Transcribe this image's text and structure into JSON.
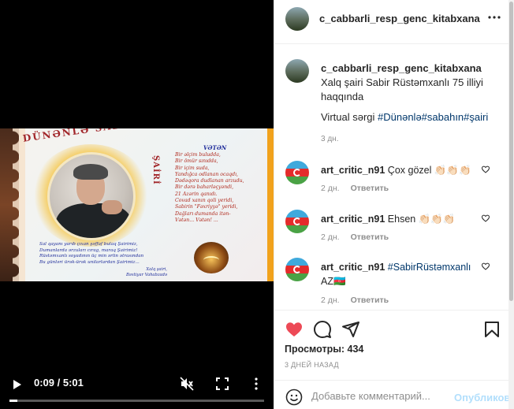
{
  "video": {
    "time": "0:09 / 5:01",
    "progress_fraction": 0.03,
    "poster": {
      "title": "DÜNƏNLƏ SABAHIN",
      "title_vertical": "ŞAİRİ",
      "poem_title": "VƏTƏN",
      "poem": "Bir əlçim buludda,\nBir ömür sınıdda,\nBir içim suda,\nYandığca odlanan ocaqdı,\nDədəqora dudlanan arzudu,\nBir dərə baharləçyəndi,\n21 Azərin qanıdı.\nCovad xanın qoli yeridi,\nSabirin \"Fəxriyyə\" yeridi,\nDağları dumanda itən-\nVətən... Vətən! ...",
      "prose": "Sal qayanı yarıb çıxan şəffaf bulaq Şairimiz,\nDumanlarda ərzuları cırag, maraq Şairimiz!\nRüstəmxanlı soyadının üç min ərlin ətrasından\nBu günləri ürək-ürək unilarlardan Şairimiz...",
      "author": "Xalq şairi,\nBəxtiyar Vahabzadə"
    }
  },
  "post": {
    "username": "c_cabbarli_resp_genc_kitabxana",
    "caption_text": "Xalq şairi Sabir Rüstəmxanlı 75 illiyi haqqında",
    "caption_line2_prefix": "Virtual sərgi ",
    "caption_tags": "#Dünənlə#sabahın#şairi",
    "caption_time": "3 дн.",
    "comments": [
      {
        "user": "art_critic_n91",
        "text": "Çox gözel 👏🏻👏🏻👏🏻",
        "time": "2 дн.",
        "reply": "Ответить"
      },
      {
        "user": "art_critic_n91",
        "text": "Ehsen 👏🏻👏🏻👏🏻",
        "time": "2 дн.",
        "reply": "Ответить"
      },
      {
        "user": "art_critic_n91",
        "text": "#SabirRüstəmxanlı",
        "text2": "AZ🇦🇿",
        "time": "2 дн.",
        "reply": "Ответить"
      }
    ],
    "views_label": "Просмотры:",
    "views_count": "434",
    "ago": "3 ДНЕЙ НАЗАД",
    "comment_placeholder": "Добавьте комментарий...",
    "publish": "Опубликовать"
  },
  "colors": {
    "like_red": "#ed4956",
    "link_blue": "#00376b",
    "muted": "#8e8e8e",
    "publish_disabled": "#b2dffc"
  },
  "icons": [
    "play-icon",
    "mute-icon",
    "fullscreen-icon",
    "more-vertical-icon",
    "more-horizontal-icon",
    "heart-icon",
    "comment-icon",
    "share-icon",
    "bookmark-icon",
    "emoji-icon"
  ]
}
